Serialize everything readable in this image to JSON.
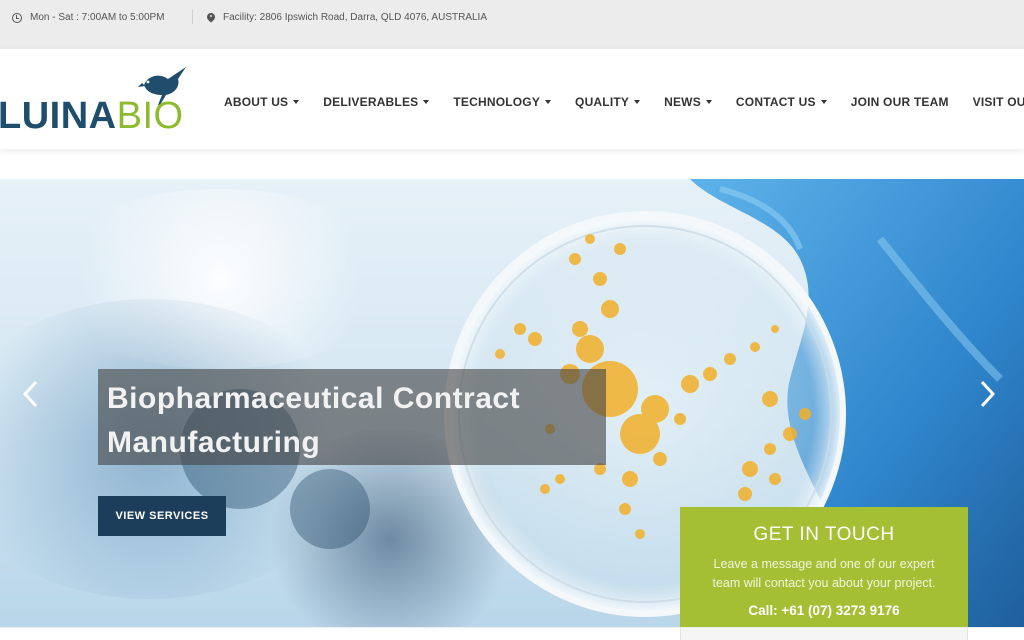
{
  "topbar": {
    "hours": "Mon - Sat : 7:00AM to 5:00PM",
    "address": "Facility: 2806 Ipswich Road, Darra, QLD 4076, AUSTRALIA"
  },
  "brand": {
    "logo_part1": "LUINA",
    "logo_part2": "BIO",
    "colors": {
      "primary": "#1f4d6b",
      "accent": "#8dbb2f"
    }
  },
  "nav": {
    "items": [
      {
        "label": "ABOUT US",
        "dropdown": true
      },
      {
        "label": "DELIVERABLES",
        "dropdown": true
      },
      {
        "label": "TECHNOLOGY",
        "dropdown": true
      },
      {
        "label": "QUALITY",
        "dropdown": true
      },
      {
        "label": "NEWS",
        "dropdown": true
      },
      {
        "label": "CONTACT US",
        "dropdown": true
      },
      {
        "label": "JOIN OUR TEAM",
        "dropdown": false
      },
      {
        "label": "VISIT OUR VIRT",
        "dropdown": false
      }
    ]
  },
  "hero": {
    "title_line1": "Biopharmaceutical Contract",
    "title_line2": "Manufacturing",
    "cta": "VIEW SERVICES",
    "prev_icon": "chevron-left-icon",
    "next_icon": "chevron-right-icon"
  },
  "touch": {
    "heading": "GET IN TOUCH",
    "line1": "Leave a message and one of our expert",
    "line2": "team will contact you about your project.",
    "call": "Call: +61 (07) 3273 9176",
    "color": "#a4bf33"
  }
}
